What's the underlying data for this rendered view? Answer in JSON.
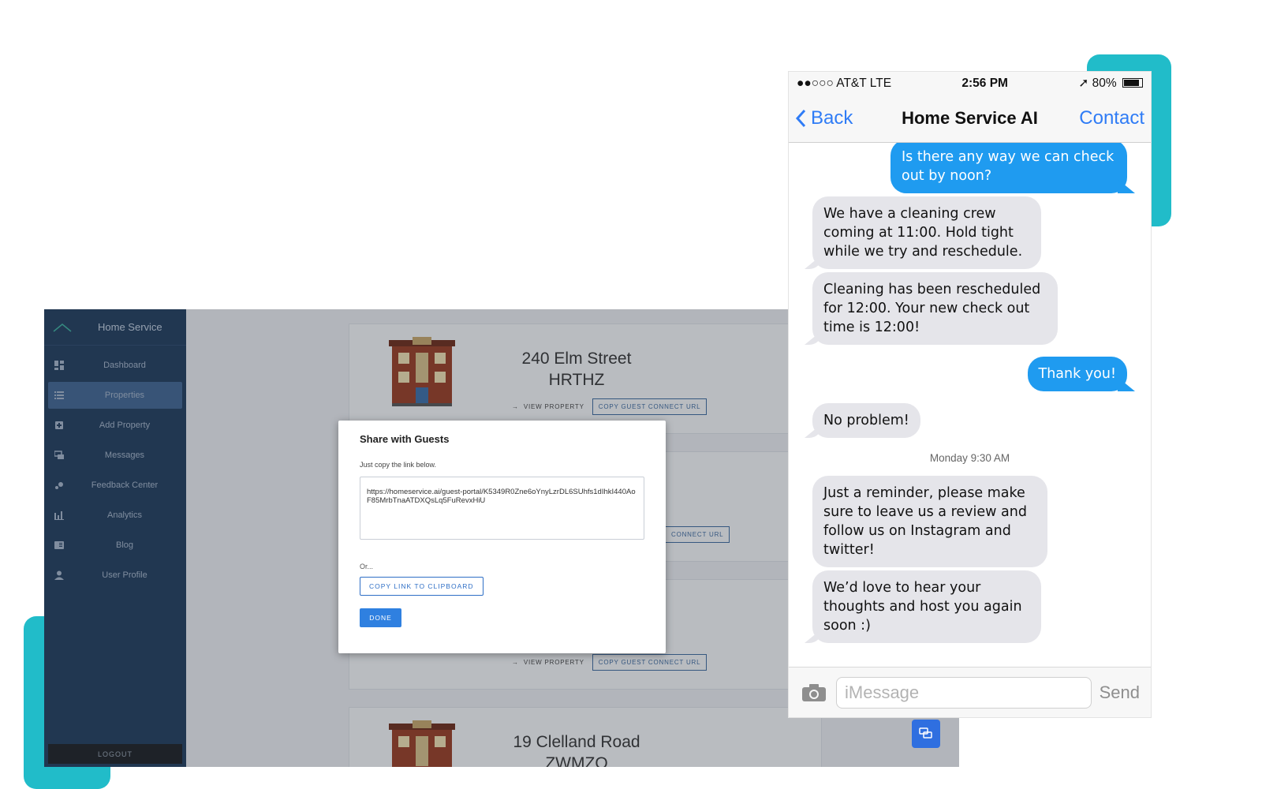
{
  "dashboard": {
    "brand_title": "Home Service",
    "nav": [
      {
        "label": "Dashboard",
        "icon": "dashboard-icon"
      },
      {
        "label": "Properties",
        "icon": "list-icon",
        "active": true
      },
      {
        "label": "Add Property",
        "icon": "add-box-icon"
      },
      {
        "label": "Messages",
        "icon": "chat-icon"
      },
      {
        "label": "Feedback Center",
        "icon": "feedback-icon"
      },
      {
        "label": "Analytics",
        "icon": "bar-chart-icon"
      },
      {
        "label": "Blog",
        "icon": "book-icon"
      },
      {
        "label": "User Profile",
        "icon": "person-icon"
      }
    ],
    "logout_label": "LOGOUT",
    "properties": [
      {
        "street": "240 Elm Street",
        "code": "HRTHZ"
      },
      {
        "street": "",
        "code": ""
      },
      {
        "street": "",
        "code": ""
      },
      {
        "street": "19 Clelland Road",
        "code": "ZWMZQ"
      }
    ],
    "view_property_label": "VIEW PROPERTY",
    "copy_url_label": "COPY GUEST CONNECT URL",
    "copy_url_label_partial": "CONNECT URL",
    "modal": {
      "title": "Share with Guests",
      "hint": "Just copy the link below.",
      "link": "https://homeservice.ai/guest-portal/K5349R0Zne6oYnyLzrDL6SUhfs1dIhkI440AoF85MrbTnaATDXQsLq5FuRevxHiU",
      "or": "Or...",
      "copy_button": "COPY LINK TO CLIPBOARD",
      "done_button": "DONE"
    },
    "colors": {
      "sidebar": "#1f3b5c",
      "accent": "#21bcc9",
      "primary": "#2f80e0"
    }
  },
  "phone": {
    "carrier": "●●○○○ AT&T LTE",
    "time": "2:56 PM",
    "battery": "80%",
    "back_label": "Back",
    "title": "Home Service AI",
    "contact_label": "Contact",
    "messages": [
      {
        "dir": "out",
        "text": "Is there any way we can check out by noon?"
      },
      {
        "dir": "in",
        "text": "We have a cleaning crew coming at 11:00. Hold tight while we try and reschedule."
      },
      {
        "dir": "in",
        "text": "Cleaning has been rescheduled for 12:00. Your new check out time is 12:00!"
      },
      {
        "dir": "out",
        "text": "Thank you!"
      },
      {
        "dir": "in",
        "text": "No problem!"
      },
      {
        "dir": "in",
        "text": "Just a reminder, please make sure to leave us a review and follow us on Instagram and twitter!"
      },
      {
        "dir": "in",
        "text": "We’d love to hear your thoughts and host you again soon :)"
      }
    ],
    "timestamp": "Monday 9:30 AM",
    "input_placeholder": "iMessage",
    "send_label": "Send"
  }
}
